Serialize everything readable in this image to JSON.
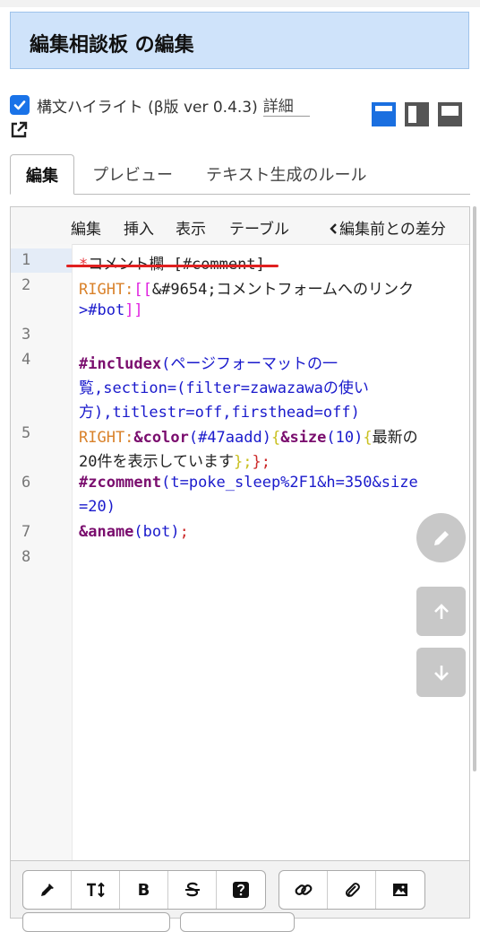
{
  "title": "編集相談板 の編集",
  "highlight": {
    "checked": true,
    "label": "構文ハイライト (β版 ver 0.4.3)",
    "link": "詳細"
  },
  "tabs": [
    "編集",
    "プレビュー",
    "テキスト生成のルール"
  ],
  "toolbar": {
    "items": [
      "編集",
      "挿入",
      "表示",
      "テーブル"
    ],
    "diff": "編集前との差分"
  },
  "code": {
    "line_numbers": [
      "1",
      "2",
      "3",
      "4",
      "5",
      "6",
      "7",
      "8"
    ],
    "l1_star": "*",
    "l1_text": "コメント欄 [#comment]",
    "l2_kw": "RIGHT:",
    "l2_br": "[[",
    "l2_text": "&#9654;コメントフォームへのリンク",
    "l2b_text": ">#bot",
    "l2b_br": "]]",
    "l4_kw": "#includex",
    "l4_a": "(ページフォーマットの一",
    "l4_b": "覧,section=(filter=zawazawaの使い",
    "l4_c": "方),titlestr=off,firsthead=off)",
    "l5_kw": "RIGHT:",
    "l5_color": "&color",
    "l5_colarg": "(#47aadd)",
    "l5_br1": "{",
    "l5_size": "&size",
    "l5_sizearg": "(10)",
    "l5_br2": "{",
    "l5_text": "最新の",
    "l5b_text": "20件を表示しています",
    "l5b_close1": "};",
    "l5b_close2": "};",
    "l6_kw": "#zcomment",
    "l6_a": "(t=poke_sleep%2F1&h=350&size",
    "l6_b": "=20)",
    "l7_kw": "&aname",
    "l7_arg": "(bot)",
    "l7_semi": ";"
  },
  "icons": [
    "checkbox-icon",
    "external-link-icon",
    "layout-top-icon",
    "layout-side-icon",
    "layout-bottom-icon",
    "chevron-left-icon",
    "pencil-icon",
    "arrow-up-icon",
    "arrow-down-icon",
    "eyedropper-icon",
    "text-size-icon",
    "bold-icon",
    "strikethrough-icon",
    "help-icon",
    "link-icon",
    "attachment-icon",
    "image-icon"
  ],
  "format_buttons": {
    "bold": "B"
  },
  "colors": {
    "accent": "#1a73e8",
    "title_bg": "#cfe3fa",
    "keyword": "#7a0d6e",
    "string": "#1a1acc"
  }
}
